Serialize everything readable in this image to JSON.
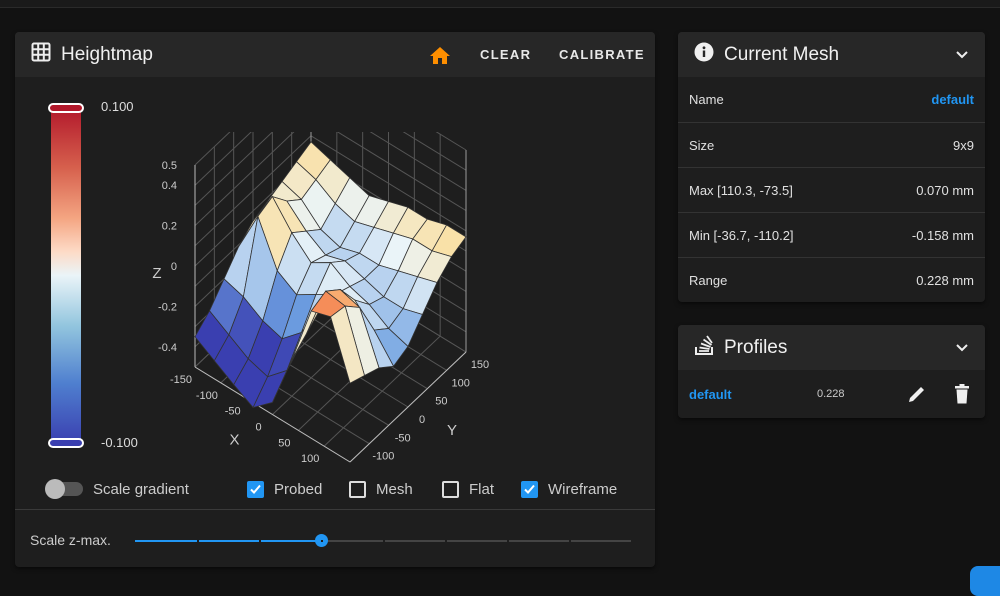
{
  "heightmap": {
    "title": "Heightmap",
    "icons": {
      "title": "grid-icon",
      "home": "home-icon"
    },
    "home_color": "#ff8f00",
    "clear_label": "CLEAR",
    "calibrate_label": "CALIBRATE",
    "colorbar": {
      "max_label": "0.100",
      "min_label": "-0.100"
    },
    "plot": {
      "x_label": "X",
      "y_label": "Y",
      "z_label": "Z",
      "x_ticks": [
        "-150",
        "-100",
        "-50",
        "0",
        "50",
        "100"
      ],
      "y_ticks": [
        "-100",
        "-50",
        "0",
        "50",
        "100",
        "150"
      ],
      "z_ticks": [
        "-0.4",
        "-0.2",
        "0",
        "0.2",
        "0.4",
        "0.5"
      ],
      "z_range": [
        -0.5,
        0.5
      ],
      "xy_range": [
        -150,
        150
      ],
      "surface_values_estimated": [
        [
          -0.1,
          -0.12,
          -0.14,
          -0.158,
          -0.13,
          -0.04,
          0.06,
          0.07,
          -0.02
        ],
        [
          -0.08,
          -0.1,
          -0.12,
          -0.13,
          -0.1,
          -0.02,
          0.07,
          0.065,
          -0.03
        ],
        [
          -0.05,
          -0.06,
          -0.08,
          -0.09,
          -0.06,
          0.0,
          0.05,
          0.04,
          -0.04
        ],
        [
          -0.02,
          0.05,
          -0.02,
          -0.04,
          -0.02,
          0.0,
          0.01,
          -0.02,
          -0.06
        ],
        [
          0.0,
          0.06,
          0.02,
          -0.01,
          0.01,
          -0.01,
          -0.02,
          -0.04,
          -0.05
        ],
        [
          0.01,
          0.03,
          0.0,
          -0.02,
          -0.01,
          -0.02,
          -0.03,
          -0.03,
          -0.02
        ],
        [
          0.02,
          0.01,
          -0.02,
          -0.03,
          -0.02,
          -0.02,
          -0.01,
          0.0,
          0.01
        ],
        [
          0.03,
          0.02,
          0.0,
          -0.01,
          0.0,
          0.01,
          0.02,
          0.02,
          0.03
        ],
        [
          0.04,
          0.03,
          0.02,
          0.01,
          0.02,
          0.03,
          0.03,
          0.04,
          0.04
        ]
      ]
    },
    "controls": {
      "scale_gradient": {
        "label": "Scale gradient",
        "on": false
      },
      "probed": {
        "label": "Probed",
        "checked": true
      },
      "mesh": {
        "label": "Mesh",
        "checked": false
      },
      "flat": {
        "label": "Flat",
        "checked": false
      },
      "wireframe": {
        "label": "Wireframe",
        "checked": true
      }
    },
    "scale_zmax": {
      "label": "Scale z-max.",
      "value_fraction": 0.375,
      "steps": 8
    }
  },
  "current_mesh": {
    "title": "Current Mesh",
    "icon": "info-icon",
    "rows": [
      {
        "label": "Name",
        "value": "default"
      },
      {
        "label": "Size",
        "value": "9x9"
      },
      {
        "label": "Max [110.3, -73.5]",
        "value": "0.070 mm"
      },
      {
        "label": "Min [-36.7, -110.2]",
        "value": "-0.158 mm"
      },
      {
        "label": "Range",
        "value": "0.228 mm"
      }
    ]
  },
  "profiles": {
    "title": "Profiles",
    "icon": "stack-icon",
    "items": [
      {
        "name": "default",
        "range": "0.228"
      }
    ]
  },
  "accent_color": "#2196f3"
}
